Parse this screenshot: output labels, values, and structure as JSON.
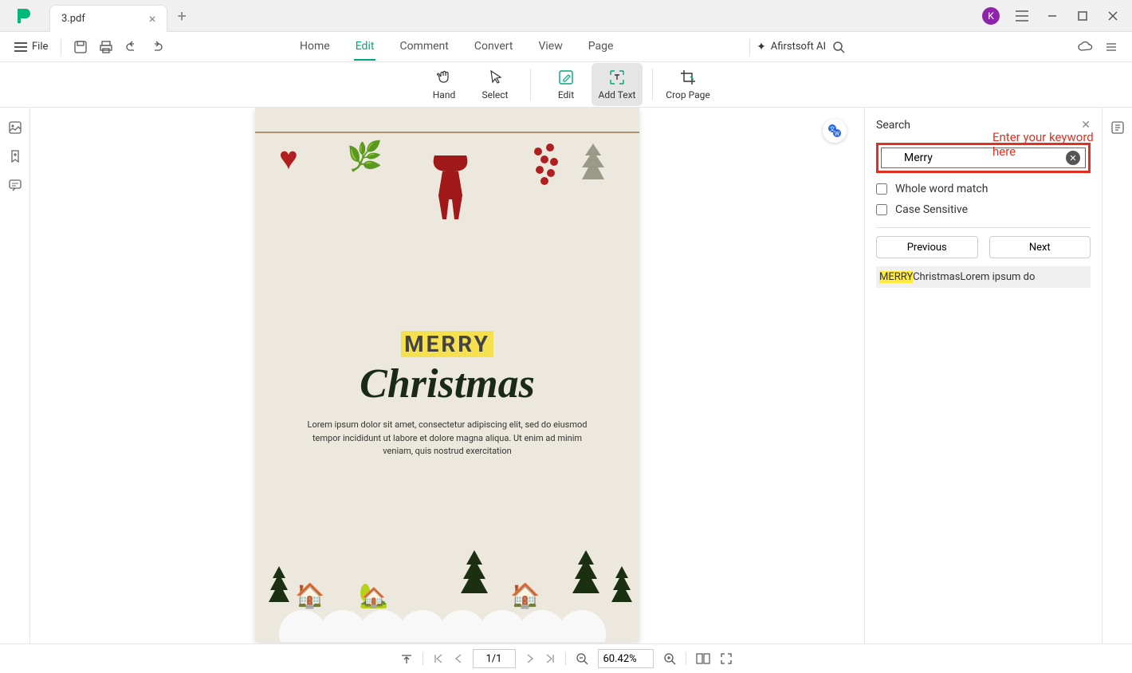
{
  "titlebar": {
    "tab_title": "3.pdf",
    "avatar_letter": "K"
  },
  "menubar": {
    "file_label": "File",
    "menu_items": [
      "Home",
      "Edit",
      "Comment",
      "Convert",
      "View",
      "Page"
    ],
    "active_index": 1,
    "ai_label": "Afirstsoft AI"
  },
  "toolbar": {
    "hand": "Hand",
    "select": "Select",
    "edit": "Edit",
    "add_text": "Add Text",
    "crop_page": "Crop Page"
  },
  "document": {
    "heading_merry": "MERRY",
    "heading_christmas": "Christmas",
    "body_text": "Lorem ipsum dolor sit amet, consectetur adipiscing elit, sed do eiusmod tempor incididunt ut labore et dolore magna aliqua. Ut enim ad minim veniam, quis nostrud exercitation"
  },
  "search": {
    "title": "Search",
    "query": "Merry",
    "annotation": "Enter your keyword here",
    "whole_word_label": "Whole word match",
    "case_sensitive_label": "Case Sensitive",
    "previous_label": "Previous",
    "next_label": "Next",
    "result_highlight": "MERRY",
    "result_rest": "ChristmasLorem ipsum do"
  },
  "statusbar": {
    "page_indicator": "1/1",
    "zoom_level": "60.42%"
  }
}
